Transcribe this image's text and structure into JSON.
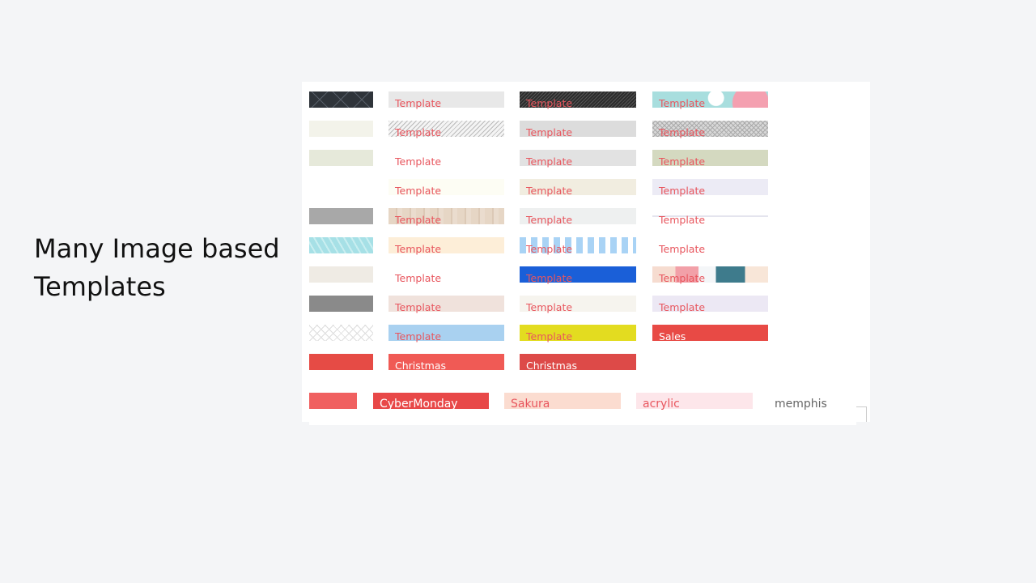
{
  "slide": {
    "heading_line1": "Many Image based",
    "heading_line2": "Templates"
  },
  "label_color": "#e8565e",
  "rows": [
    [
      {
        "label": "",
        "bg": "#2f343a",
        "pattern": "darkgrid"
      },
      {
        "label": "Template",
        "bg": "#e8e8e8"
      },
      {
        "label": "Template",
        "bg": "#2c2c2c",
        "pattern": "darkstripes"
      },
      {
        "label": "Template",
        "bg": "#a8dede",
        "pattern": "teal"
      }
    ],
    [
      {
        "label": "",
        "bg": "#f3f3ea"
      },
      {
        "label": "Template",
        "bg": "#f4f4f4",
        "pattern": "stripes"
      },
      {
        "label": "Template",
        "bg": "#dcdcdc"
      },
      {
        "label": "Template",
        "bg": "#d0d0d0",
        "pattern": "check"
      }
    ],
    [
      {
        "label": "",
        "bg": "#e6e9da"
      },
      {
        "label": "Template",
        "bg": "#ffffff"
      },
      {
        "label": "Template",
        "bg": "#e2e2e2"
      },
      {
        "label": "Template",
        "bg": "#d4d9c0"
      }
    ],
    [
      {
        "label": "",
        "bg": "#ffffff"
      },
      {
        "label": "Template",
        "bg": "#fdfdf4"
      },
      {
        "label": "Template",
        "bg": "#f1ede0"
      },
      {
        "label": "Template",
        "bg": "#ecebf5"
      }
    ],
    [
      {
        "label": "",
        "bg": "#a8a8a8"
      },
      {
        "label": "Template",
        "bg": "#e5d6c6",
        "pattern": "wood"
      },
      {
        "label": "Template",
        "bg": "#eef0f0"
      },
      {
        "label": "Template",
        "bg": "#ffffff",
        "pattern": "lines"
      }
    ],
    [
      {
        "label": "",
        "bg": "#a6e0e6",
        "pattern": "chevron"
      },
      {
        "label": "Template",
        "bg": "#fdeed8"
      },
      {
        "label": "Template",
        "bg": "#a9d3f5",
        "pattern": "vstripes"
      },
      {
        "label": "Template",
        "bg": "#ffffff"
      }
    ],
    [
      {
        "label": "",
        "bg": "#efebe4"
      },
      {
        "label": "Template",
        "bg": "#ffffff"
      },
      {
        "label": "Template",
        "bg": "#1a5fd8"
      },
      {
        "label": "Template",
        "bg": "#f6dcd0",
        "pattern": "triangles"
      }
    ],
    [
      {
        "label": "",
        "bg": "#8a8a8a"
      },
      {
        "label": "Template",
        "bg": "#f0e2dc"
      },
      {
        "label": "Template",
        "bg": "#f6f4ee"
      },
      {
        "label": "Template",
        "bg": "#ece8f4"
      }
    ],
    [
      {
        "label": "",
        "bg": "#ffffff",
        "pattern": "lattice"
      },
      {
        "label": "Template",
        "bg": "#a9d1f0"
      },
      {
        "label": "Template",
        "bg": "#e3dc20"
      },
      {
        "label": "Sales",
        "bg": "#e84a45",
        "light": true
      }
    ],
    [
      {
        "label": "",
        "bg": "#e64b45"
      },
      {
        "label": "Christmas",
        "bg": "#f05a55",
        "light": true
      },
      {
        "label": "Christmas",
        "bg": "#dd4a48",
        "light": true
      }
    ]
  ],
  "bottom_row": [
    {
      "label": "",
      "bg": "#f06060"
    },
    {
      "label": "CyberMonday",
      "bg": "#e84848",
      "light": true
    },
    {
      "label": "Sakura",
      "bg": "#fbdcd0"
    },
    {
      "label": "acrylic",
      "bg": "#fde6ea"
    },
    {
      "label": "memphis",
      "bg": "#ffffff",
      "gray": true
    }
  ]
}
